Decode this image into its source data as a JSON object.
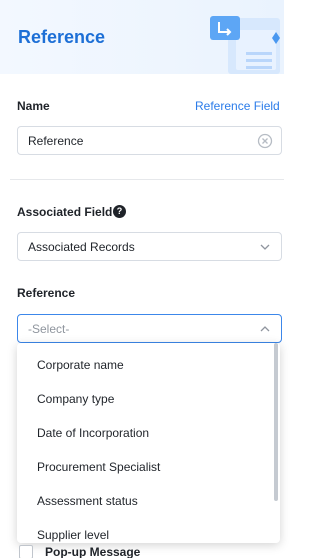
{
  "header": {
    "title": "Reference"
  },
  "name_section": {
    "label": "Name",
    "link": "Reference Field",
    "value": "Reference"
  },
  "associated_field": {
    "label": "Associated Field",
    "help": "?",
    "value": "Associated Records"
  },
  "reference": {
    "label": "Reference",
    "placeholder": "-Select-",
    "options": [
      "Corporate name",
      "Company type",
      "Date of Incorporation",
      "Procurement Specialist",
      "Assessment status",
      "Supplier level"
    ]
  },
  "popup": {
    "label": "Pop-up Message"
  },
  "colors": {
    "accent": "#2b7ce9",
    "title": "#1d6fd6",
    "focus_border": "#3c87ea"
  },
  "icons": [
    "clear-icon",
    "chevron-down-icon",
    "chevron-up-icon",
    "help-icon",
    "header-illustration"
  ]
}
